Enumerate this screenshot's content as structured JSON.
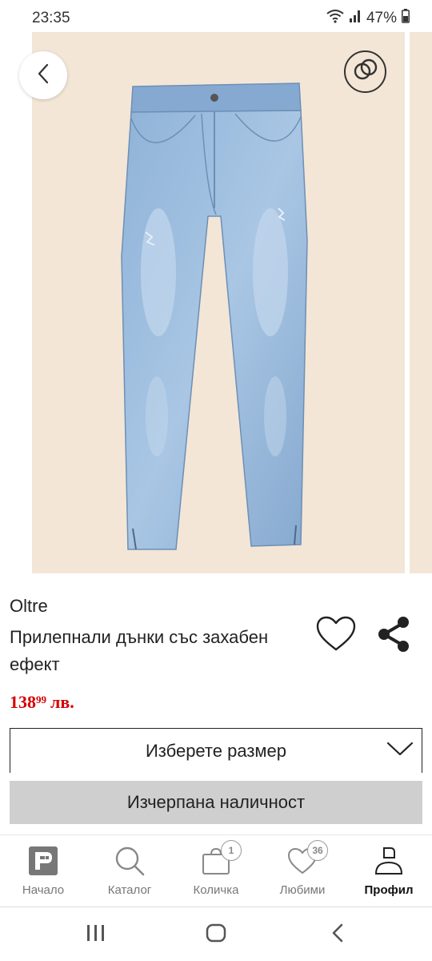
{
  "status": {
    "time": "23:35",
    "battery": "47%",
    "icons": [
      "wifi-icon",
      "signal-icon",
      "battery-icon"
    ]
  },
  "gallery": {
    "background_color": "#f3e6d6",
    "image_alt": "jeans-product-image",
    "slide_count": 3,
    "active_index": 0
  },
  "product": {
    "brand": "Oltre",
    "title": "Прилепнали дънки със захабен ефект",
    "price_whole": "138",
    "price_cents": "99",
    "price_currency": "лв.",
    "price_color": "#d40000"
  },
  "size_select": {
    "label": "Изберете размер"
  },
  "availability_button": {
    "label": "Изчерпана наличност",
    "background": "#cfcfcf"
  },
  "bottom_nav": {
    "items": [
      {
        "label": "Начало",
        "icon": "home-logo-icon"
      },
      {
        "label": "Каталог",
        "icon": "search-icon"
      },
      {
        "label": "Количка",
        "icon": "cart-icon",
        "badge": "1"
      },
      {
        "label": "Любими",
        "icon": "heart-icon",
        "badge": "36"
      },
      {
        "label": "Профил",
        "icon": "profile-icon",
        "active": true
      }
    ]
  },
  "system_nav": {
    "buttons": [
      "recent-apps",
      "home",
      "back"
    ]
  }
}
